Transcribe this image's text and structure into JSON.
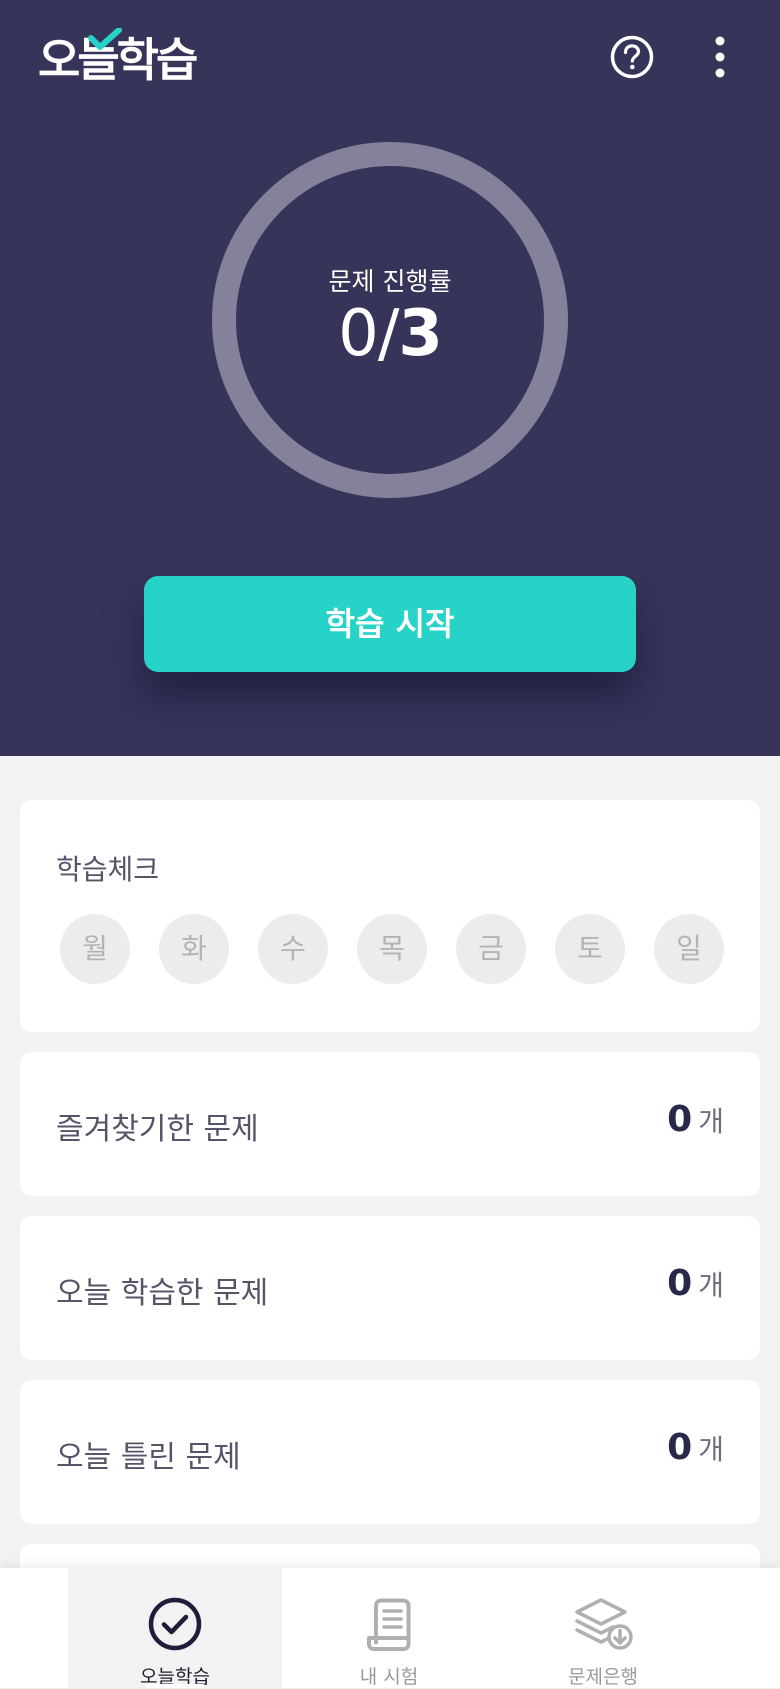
{
  "app": {
    "logo_text": "오늘학습"
  },
  "header": {
    "help_icon": "question-circle-icon",
    "more_icon": "vertical-dots-icon"
  },
  "progress": {
    "label": "문제 진행률",
    "done": "0",
    "separator": "/",
    "total": "3",
    "fraction_complete": 0
  },
  "start_button": {
    "label": "학습 시작"
  },
  "study_check": {
    "title": "학습체크",
    "days": [
      "월",
      "화",
      "수",
      "목",
      "금",
      "토",
      "일"
    ]
  },
  "stats": [
    {
      "label": "즐겨찾기한 문제",
      "value": "0",
      "unit": "개"
    },
    {
      "label": "오늘 학습한 문제",
      "value": "0",
      "unit": "개"
    },
    {
      "label": "오늘 틀린 문제",
      "value": "0",
      "unit": "개"
    }
  ],
  "bottom_nav": {
    "items": [
      {
        "label": "오늘학습",
        "icon": "check-circle-icon",
        "active": true
      },
      {
        "label": "내 시험",
        "icon": "scroll-document-icon",
        "active": false
      },
      {
        "label": "문제은행",
        "icon": "layers-download-icon",
        "active": false
      }
    ]
  },
  "colors": {
    "hero_background": "#37345a",
    "accent": "#27d3c6",
    "ring_track": "#84829a",
    "page_background": "#f2f2f2"
  }
}
